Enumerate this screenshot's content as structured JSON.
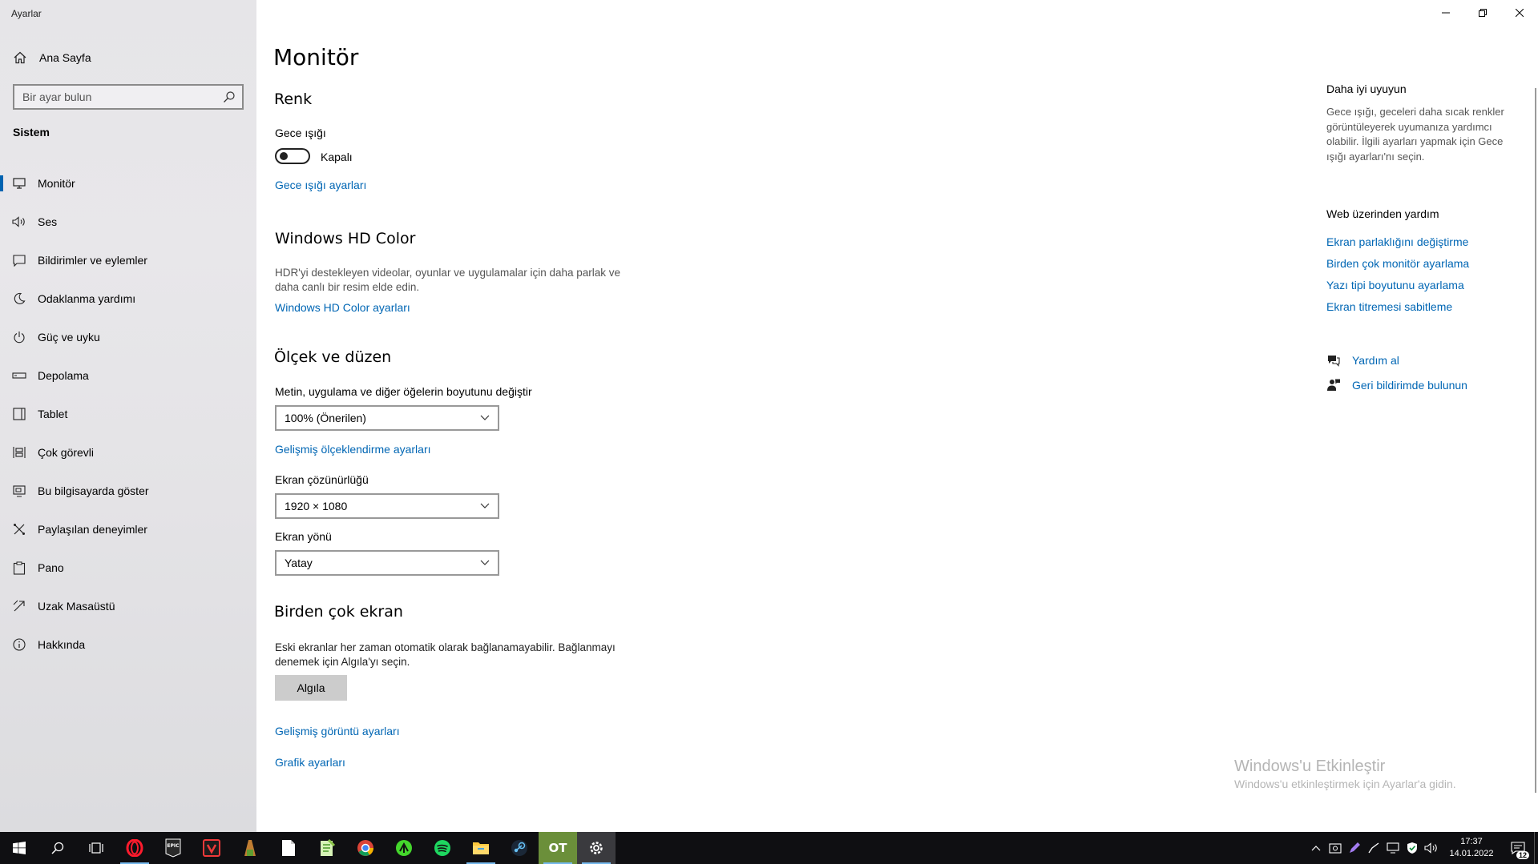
{
  "window": {
    "title": "Ayarlar"
  },
  "sidebar": {
    "home_label": "Ana Sayfa",
    "search_placeholder": "Bir ayar bulun",
    "section": "Sistem",
    "items": [
      {
        "label": "Monitör",
        "icon": "monitor-icon",
        "active": true
      },
      {
        "label": "Ses",
        "icon": "speaker-icon"
      },
      {
        "label": "Bildirimler ve eylemler",
        "icon": "notification-icon"
      },
      {
        "label": "Odaklanma yardımı",
        "icon": "moon-icon"
      },
      {
        "label": "Güç ve uyku",
        "icon": "power-icon"
      },
      {
        "label": "Depolama",
        "icon": "storage-icon"
      },
      {
        "label": "Tablet",
        "icon": "tablet-icon"
      },
      {
        "label": "Çok görevli",
        "icon": "multitask-icon"
      },
      {
        "label": "Bu bilgisayarda göster",
        "icon": "project-icon"
      },
      {
        "label": "Paylaşılan deneyimler",
        "icon": "shared-icon"
      },
      {
        "label": "Pano",
        "icon": "clipboard-icon"
      },
      {
        "label": "Uzak Masaüstü",
        "icon": "remote-icon"
      },
      {
        "label": "Hakkında",
        "icon": "info-icon"
      }
    ]
  },
  "main": {
    "title": "Monitör",
    "color": {
      "heading": "Renk",
      "night_light_label": "Gece ışığı",
      "toggle_state": "Kapalı",
      "night_light_settings_link": "Gece ışığı ayarları"
    },
    "hd_color": {
      "heading": "Windows HD Color",
      "description": "HDR'yi destekleyen videolar, oyunlar ve uygulamalar için daha parlak ve daha canlı bir resim elde edin.",
      "link": "Windows HD Color ayarları"
    },
    "scale": {
      "heading": "Ölçek ve düzen",
      "size_label": "Metin, uygulama ve diğer öğelerin boyutunu değiştir",
      "size_value": "100% (Önerilen)",
      "advanced_link": "Gelişmiş ölçeklendirme ayarları",
      "resolution_label": "Ekran çözünürlüğü",
      "resolution_value": "1920 × 1080",
      "orientation_label": "Ekran yönü",
      "orientation_value": "Yatay"
    },
    "multi": {
      "heading": "Birden çok ekran",
      "description": "Eski ekranlar her zaman otomatik olarak bağlanamayabilir. Bağlanmayı denemek için Algıla'yı seçin.",
      "detect_button": "Algıla",
      "advanced_display_link": "Gelişmiş görüntü ayarları",
      "graphics_link": "Grafik ayarları"
    }
  },
  "right": {
    "sleep_title": "Daha iyi uyuyun",
    "sleep_desc": "Gece ışığı, geceleri daha sıcak renkler görüntüleyerek uyumanıza yardımcı olabilir. İlgili ayarları yapmak için Gece ışığı ayarları'nı seçin.",
    "web_help_title": "Web üzerinden yardım",
    "web_links": [
      "Ekran parlaklığını değiştirme",
      "Birden çok monitör ayarlama",
      "Yazı tipi boyutunu ayarlama",
      "Ekran titremesi sabitleme"
    ],
    "get_help": "Yardım al",
    "feedback": "Geri bildirimde bulunun"
  },
  "watermark": {
    "line1": "Windows'u Etkinleştir",
    "line2": "Windows'u etkinleştirmek için Ayarlar'a gidin."
  },
  "taskbar": {
    "time": "17:37",
    "date": "14.01.2022",
    "notification_count": "12",
    "apps": [
      "start-icon",
      "search-icon",
      "task-view-icon",
      "opera-icon",
      "epic-games-icon",
      "vivaldi-icon",
      "minecraft-icon",
      "notepad-icon",
      "notepad-plus-icon",
      "chrome-icon",
      "razer-icon",
      "spotify-icon",
      "file-explorer-icon",
      "steam-icon",
      "ot-app-icon",
      "settings-icon"
    ]
  },
  "colors": {
    "accent": "#0063b1",
    "link": "#0066b4",
    "taskbar": "#0f0f12"
  }
}
